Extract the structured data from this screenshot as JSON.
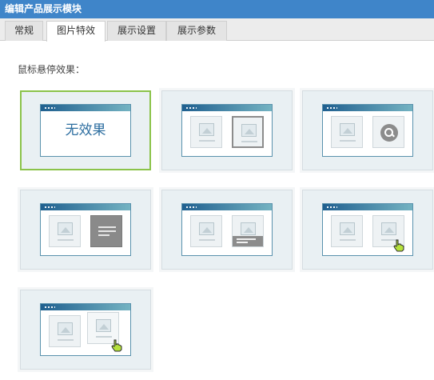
{
  "window": {
    "title": "编辑产品展示模块"
  },
  "tabs": [
    {
      "label": "常规"
    },
    {
      "label": "图片特效",
      "active": true
    },
    {
      "label": "展示设置"
    },
    {
      "label": "展示参数"
    }
  ],
  "hover_effect": {
    "label": "鼠标悬停效果：",
    "options": [
      {
        "name": "no-effect",
        "text": "无效果",
        "selected": true
      },
      {
        "name": "border-highlight"
      },
      {
        "name": "zoom-icon"
      },
      {
        "name": "grey-overlay"
      },
      {
        "name": "caption-slide"
      },
      {
        "name": "cursor-hover-right"
      },
      {
        "name": "cursor-hover-shift"
      }
    ]
  },
  "colors": {
    "title_bar": "#3f85c9",
    "selected_border": "#8bc34a",
    "window_header": "#1f5f8f",
    "cursor": "#9acd32"
  },
  "icons": [
    "image-icon",
    "zoom-icon",
    "hand-cursor-icon"
  ]
}
